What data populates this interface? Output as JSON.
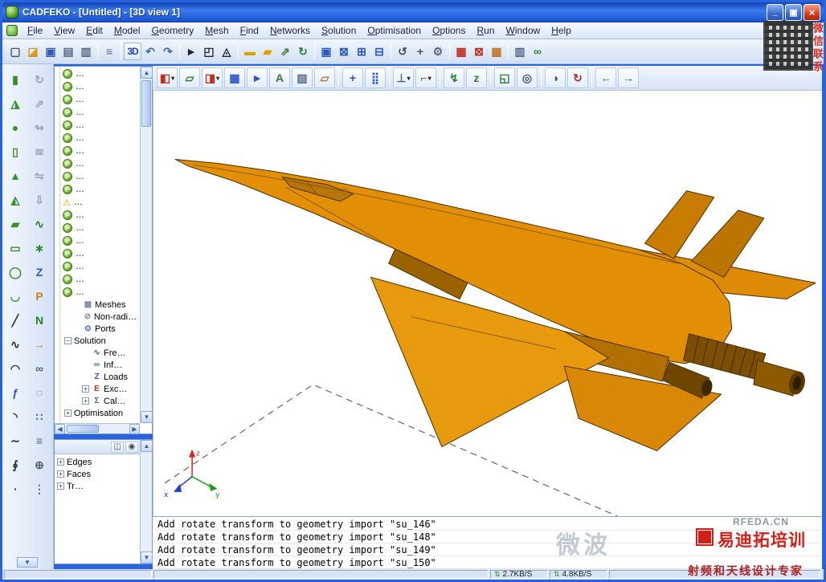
{
  "window": {
    "title": "CADFEKO - [Untitled] - [3D view 1]",
    "controls": [
      {
        "name": "minimize-button",
        "glyph": "_"
      },
      {
        "name": "restore-button",
        "glyph": "▣"
      },
      {
        "name": "close-button",
        "glyph": "×"
      }
    ]
  },
  "menu": {
    "items": [
      {
        "name": "menu-file",
        "label": "File"
      },
      {
        "name": "menu-view",
        "label": "View"
      },
      {
        "name": "menu-edit",
        "label": "Edit"
      },
      {
        "name": "menu-model",
        "label": "Model"
      },
      {
        "name": "menu-geometry",
        "label": "Geometry"
      },
      {
        "name": "menu-mesh",
        "label": "Mesh"
      },
      {
        "name": "menu-find",
        "label": "Find"
      },
      {
        "name": "menu-networks",
        "label": "Networks"
      },
      {
        "name": "menu-solution",
        "label": "Solution"
      },
      {
        "name": "menu-optimisation",
        "label": "Optimisation"
      },
      {
        "name": "menu-options",
        "label": "Options"
      },
      {
        "name": "menu-run",
        "label": "Run"
      },
      {
        "name": "menu-window",
        "label": "Window"
      },
      {
        "name": "menu-help",
        "label": "Help"
      }
    ]
  },
  "toolbar_main": {
    "groups": [
      [
        {
          "name": "new-document",
          "glyph": "▢",
          "color": "#44526e"
        },
        {
          "name": "open-folder",
          "glyph": "◪",
          "color": "#d89a18"
        },
        {
          "name": "save-file",
          "glyph": "▣",
          "color": "#2f5bb0"
        },
        {
          "name": "print",
          "glyph": "▤",
          "color": "#5a6a85"
        },
        {
          "name": "print-report",
          "glyph": "▥",
          "color": "#5a6a85"
        }
      ],
      [
        {
          "name": "notes-report",
          "glyph": "≡",
          "color": "#5a6a85"
        }
      ],
      [
        {
          "name": "3d-view-button",
          "glyph": "3D",
          "color": "#1b47c8"
        }
      ],
      [
        {
          "name": "undo",
          "glyph": "↶",
          "color": "#3c6ea5"
        },
        {
          "name": "redo",
          "glyph": "↷",
          "color": "#3c6ea5"
        }
      ],
      [
        {
          "name": "select-pointer",
          "glyph": "►",
          "color": "#222831"
        },
        {
          "name": "select-geometry",
          "glyph": "◰",
          "color": "#222831"
        },
        {
          "name": "select-mesh",
          "glyph": "◬",
          "color": "#222831"
        }
      ],
      [
        {
          "name": "create-rectangle-face",
          "glyph": "▬",
          "color": "#d8a300"
        },
        {
          "name": "create-polygon-face",
          "glyph": "▰",
          "color": "#d8a300"
        }
      ],
      [
        {
          "name": "extrude-face",
          "glyph": "⇗",
          "color": "#2e7d32"
        },
        {
          "name": "spin-face",
          "glyph": "↻",
          "color": "#2e7d32"
        }
      ],
      [
        {
          "name": "create-solid",
          "glyph": "▣",
          "color": "#2a56c8"
        },
        {
          "name": "delete-solid",
          "glyph": "⊠",
          "color": "#2a56c8"
        },
        {
          "name": "union-solids",
          "glyph": "⊞",
          "color": "#2a56c8"
        },
        {
          "name": "subtract-solids",
          "glyph": "⊟",
          "color": "#2a56c8"
        }
      ],
      [
        {
          "name": "rotate-transform",
          "glyph": "↺",
          "color": "#445566"
        },
        {
          "name": "translate-transform",
          "glyph": "+",
          "color": "#445566"
        }
      ],
      [
        {
          "name": "search-settings",
          "glyph": "⚙",
          "color": "#5a6a85"
        }
      ],
      [
        {
          "name": "create-mesh",
          "glyph": "▦",
          "color": "#c03020"
        },
        {
          "name": "delete-mesh",
          "glyph": "⊠",
          "color": "#c03020"
        },
        {
          "name": "refine-mesh",
          "glyph": "▩",
          "color": "#c07830"
        }
      ],
      [
        {
          "name": "mesh-statistics",
          "glyph": "▥",
          "color": "#5a6a85"
        },
        {
          "name": "cable-connection",
          "glyph": "∞",
          "color": "#2e7d32"
        }
      ]
    ]
  },
  "toolbar_view": {
    "groups": [
      [
        {
          "name": "view-preset",
          "glyph": "◧",
          "color": "#c23020",
          "dd": "▾"
        },
        {
          "name": "new-3d-view",
          "glyph": "▱",
          "color": "#2e7d32"
        },
        {
          "name": "render-preset",
          "glyph": "◨",
          "color": "#c23020",
          "dd": "▾"
        },
        {
          "name": "mesh-display",
          "glyph": "▦",
          "color": "#2a56c8"
        },
        {
          "name": "cutplane",
          "glyph": "►",
          "color": "#2a56c8"
        },
        {
          "name": "add-text-label",
          "glyph": "A",
          "color": "#2e7d32"
        },
        {
          "name": "save-image",
          "glyph": "▨",
          "color": "#56708e"
        },
        {
          "name": "measure-distance",
          "glyph": "▱",
          "color": "#b08030"
        }
      ],
      [
        {
          "name": "toggle-axes",
          "glyph": "+",
          "color": "#2a56c8"
        },
        {
          "name": "toggle-grid",
          "glyph": "⣿",
          "color": "#2a56c8"
        }
      ],
      [
        {
          "name": "workplane-select",
          "glyph": "⊥",
          "color": "#556677",
          "dd": "▾"
        },
        {
          "name": "workplane-new",
          "glyph": "⌐",
          "color": "#556677",
          "dd": "▾"
        }
      ],
      [
        {
          "name": "align-tool",
          "glyph": "↯",
          "color": "#2e7d32"
        },
        {
          "name": "edit-z-axis",
          "glyph": "z",
          "color": "#2e7d32"
        }
      ],
      [
        {
          "name": "zoom-extents",
          "glyph": "◱",
          "color": "#2e7d32"
        },
        {
          "name": "zoom-to-window",
          "glyph": "◎",
          "color": "#445566"
        }
      ],
      [
        {
          "name": "shaded-mode",
          "glyph": "◑",
          "color": "#445566"
        },
        {
          "name": "spin-model",
          "glyph": "↻",
          "color": "#b03030"
        }
      ],
      [
        {
          "name": "previous-view",
          "glyph": "←",
          "color": "#2e7d32"
        },
        {
          "name": "next-view",
          "glyph": "→",
          "color": "#2e7d32"
        }
      ]
    ]
  },
  "left_toolbar": {
    "column_a": [
      {
        "name": "create-cuboid",
        "glyph": "▮",
        "color": "#3a8f2a"
      },
      {
        "name": "create-flare",
        "glyph": "◮",
        "color": "#3a8f2a"
      },
      {
        "name": "create-sphere",
        "glyph": "●",
        "color": "#3a8f2a"
      },
      {
        "name": "create-cylinder",
        "glyph": "▯",
        "color": "#3a8f2a"
      },
      {
        "name": "create-cone",
        "glyph": "▲",
        "color": "#3a8f2a"
      },
      {
        "name": "create-pyramid",
        "glyph": "◭",
        "color": "#3a8f2a"
      },
      {
        "name": "create-polygon-plate",
        "glyph": "▰",
        "color": "#3a8f2a"
      },
      {
        "name": "create-rectangle-plate",
        "glyph": "▭",
        "color": "#3a8f2a"
      },
      {
        "name": "create-ellipse",
        "glyph": "◯",
        "color": "#3a8f2a"
      },
      {
        "name": "create-paraboloid",
        "glyph": "◡",
        "color": "#3a8f2a"
      },
      {
        "name": "create-line",
        "glyph": "╱",
        "color": "#333333"
      },
      {
        "name": "create-polyline",
        "glyph": "∿",
        "color": "#333333"
      },
      {
        "name": "create-arc",
        "glyph": "◠",
        "color": "#333333"
      },
      {
        "name": "create-function-curve",
        "glyph": "ƒ",
        "color": "#2a56c8"
      },
      {
        "name": "create-elliptic-arc",
        "glyph": "◝",
        "color": "#333333"
      },
      {
        "name": "create-bezier-curve",
        "glyph": "∼",
        "color": "#333333"
      },
      {
        "name": "create-helix",
        "glyph": "∮",
        "color": "#333333"
      },
      {
        "name": "create-point",
        "glyph": "∙",
        "color": "#333333"
      }
    ],
    "column_b": [
      {
        "name": "spin-tool",
        "glyph": "↻",
        "color": "#9aa6b8"
      },
      {
        "name": "sweep-tool",
        "glyph": "⇗",
        "color": "#9aa6b8"
      },
      {
        "name": "twist-tool",
        "glyph": "↬",
        "color": "#9aa6b8"
      },
      {
        "name": "loft-tool",
        "glyph": "≋",
        "color": "#9aa6b8"
      },
      {
        "name": "mirror-tool",
        "glyph": "⇋",
        "color": "#9aa6b8"
      },
      {
        "name": "project-tool",
        "glyph": "⇩",
        "color": "#9aa6b8"
      },
      {
        "name": "waveguide-port",
        "glyph": "∿",
        "color": "#2e7d32"
      },
      {
        "name": "mesh-point",
        "glyph": "∗",
        "color": "#2e7d32"
      },
      {
        "name": "z-direction-tool",
        "glyph": "Z",
        "color": "#2a56c8"
      },
      {
        "name": "add-port",
        "glyph": "P",
        "color": "#e07820"
      },
      {
        "name": "add-network",
        "glyph": "N",
        "color": "#2e7d32"
      },
      {
        "name": "apply-transform",
        "glyph": "→",
        "color": "#e07820"
      },
      {
        "name": "infinite-plane",
        "glyph": "∞",
        "color": "#556677"
      },
      {
        "name": "ring-tool",
        "glyph": "◌",
        "color": "#556677"
      },
      {
        "name": "array-tool",
        "glyph": "∷",
        "color": "#556677"
      },
      {
        "name": "layers-tool",
        "glyph": "≡",
        "color": "#556677"
      },
      {
        "name": "anchor-tool",
        "glyph": "⊕",
        "color": "#556677"
      },
      {
        "name": "more-tools",
        "glyph": "⋮",
        "color": "#556677"
      }
    ]
  },
  "tree": {
    "part_glyph": "P",
    "warning_glyph": "⚠",
    "p_items_a": [
      {
        "label": "…"
      },
      {
        "label": "…"
      },
      {
        "label": "…"
      },
      {
        "label": "…"
      },
      {
        "label": "…"
      },
      {
        "label": "…"
      },
      {
        "label": "…"
      },
      {
        "label": "…"
      },
      {
        "label": "…"
      },
      {
        "label": "…"
      }
    ],
    "warning_item": {
      "label": "…"
    },
    "p_items_b": [
      {
        "label": "…"
      },
      {
        "label": "…"
      },
      {
        "label": "…"
      },
      {
        "label": "…"
      },
      {
        "label": "…"
      },
      {
        "label": "…"
      },
      {
        "label": "…"
      }
    ],
    "items": [
      {
        "name": "tree-item-meshes",
        "label": "Meshes",
        "indent": 1,
        "icon": "▦",
        "icon_color": "#7a8aa0",
        "expander": ""
      },
      {
        "name": "tree-item-non-radiating",
        "label": "Non-radiat…",
        "indent": 1,
        "icon": "⊘",
        "icon_color": "#7a8aa0",
        "expander": ""
      },
      {
        "name": "tree-item-ports",
        "label": "Ports",
        "indent": 1,
        "icon": "⊙",
        "icon_color": "#2a56c8",
        "expander": ""
      },
      {
        "name": "tree-item-solution",
        "label": "Solution",
        "indent": 0,
        "icon": "",
        "icon_color": "",
        "expander": "−"
      },
      {
        "name": "tree-item-frequency",
        "label": "Fre…",
        "indent": 2,
        "icon": "∿",
        "icon_color": "#2e7d32",
        "expander": ""
      },
      {
        "name": "tree-item-infinite-planes",
        "label": "Inf…",
        "indent": 2,
        "icon": "∞",
        "icon_color": "#2e7d32",
        "expander": ""
      },
      {
        "name": "tree-item-loads",
        "label": "Loads",
        "indent": 2,
        "icon": "Z",
        "icon_color": "#2a56c8",
        "expander": ""
      },
      {
        "name": "tree-item-excitations",
        "label": "Exc…",
        "indent": 2,
        "icon": "E",
        "icon_color": "#c03020",
        "expander": "+"
      },
      {
        "name": "tree-item-calculation",
        "label": "Cal…",
        "indent": 2,
        "icon": "Σ",
        "icon_color": "#556677",
        "expander": "+"
      },
      {
        "name": "tree-item-optimisation",
        "label": "Optimisation",
        "indent": 0,
        "icon": "",
        "icon_color": "",
        "expander": "+"
      }
    ]
  },
  "details_panel": {
    "toolbar": [
      {
        "name": "visibility-toggle",
        "glyph": "◫"
      },
      {
        "name": "snapshot-view",
        "glyph": "◉"
      }
    ],
    "items": [
      {
        "name": "details-item-edges",
        "label": "Edges",
        "expander": "+"
      },
      {
        "name": "details-item-faces",
        "label": "Faces",
        "expander": "+"
      },
      {
        "name": "details-item-tr",
        "label": "Tr…",
        "expander": "+"
      }
    ]
  },
  "viewport": {
    "axes": {
      "x": "x",
      "y": "y",
      "z": "z"
    },
    "aircraft_color": "#e28f06"
  },
  "messages": {
    "lines": [
      "Add rotate transform to geometry import \"su_146\"",
      "Add rotate transform to geometry import \"su_148\"",
      "Add rotate transform to geometry import \"su_149\"",
      "Add rotate transform to geometry import \"su_150\""
    ]
  },
  "statusbar": {
    "segments": [
      {
        "name": "status-net-up",
        "icon": "⇅",
        "value": "2.7KB/S"
      },
      {
        "name": "status-net-down",
        "icon": "⇅",
        "value": "4.8KB/S"
      }
    ]
  },
  "scrollbar": {
    "up": "▲",
    "down": "▼",
    "left": "◀",
    "right": "▶"
  },
  "watermarks": {
    "wechat_contact": "微信联系",
    "site": "RFEDA.CN",
    "brand": "易迪拓培训",
    "slogan": "射频和天线设计专家",
    "forum": "微波"
  }
}
